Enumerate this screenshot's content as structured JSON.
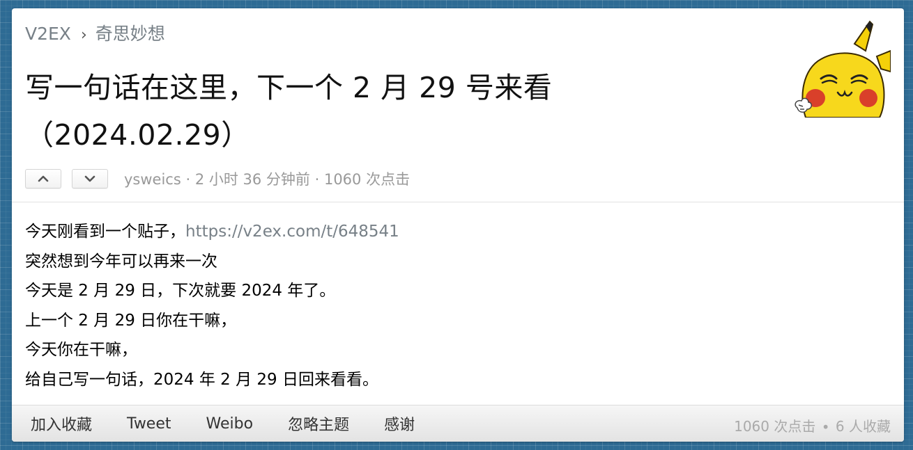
{
  "breadcrumb": {
    "site": "V2EX",
    "separator": "›",
    "node": "奇思妙想"
  },
  "topic": {
    "title": "写一句话在这里，下一个 2 月 29 号来看（2024.02.29）",
    "author": "ysweics",
    "meta_rest": " · 2 小时 36 分钟前 · 1060 次点击"
  },
  "votes": {
    "up_icon": "chevron-up-icon",
    "down_icon": "chevron-down-icon"
  },
  "content": {
    "line1_text": "今天刚看到一个贴子，",
    "line1_link": "https://v2ex.com/t/648541",
    "lines": [
      "突然想到今年可以再来一次",
      "今天是 2 月 29 日，下次就要 2024 年了。",
      "上一个 2 月 29 日你在干嘛，",
      "今天你在干嘛，",
      "给自己写一句话，2024 年 2 月 29 日回来看看。"
    ]
  },
  "toolbar": {
    "favorite": "加入收藏",
    "tweet": "Tweet",
    "weibo": "Weibo",
    "ignore": "忽略主题",
    "thanks": "感谢"
  },
  "stats": {
    "clicks": "1060 次点击",
    "separator": "∙",
    "favorites": "6 人收藏"
  },
  "colors": {
    "background": "#2e6b94",
    "muted": "#778087",
    "meta": "#999999"
  }
}
